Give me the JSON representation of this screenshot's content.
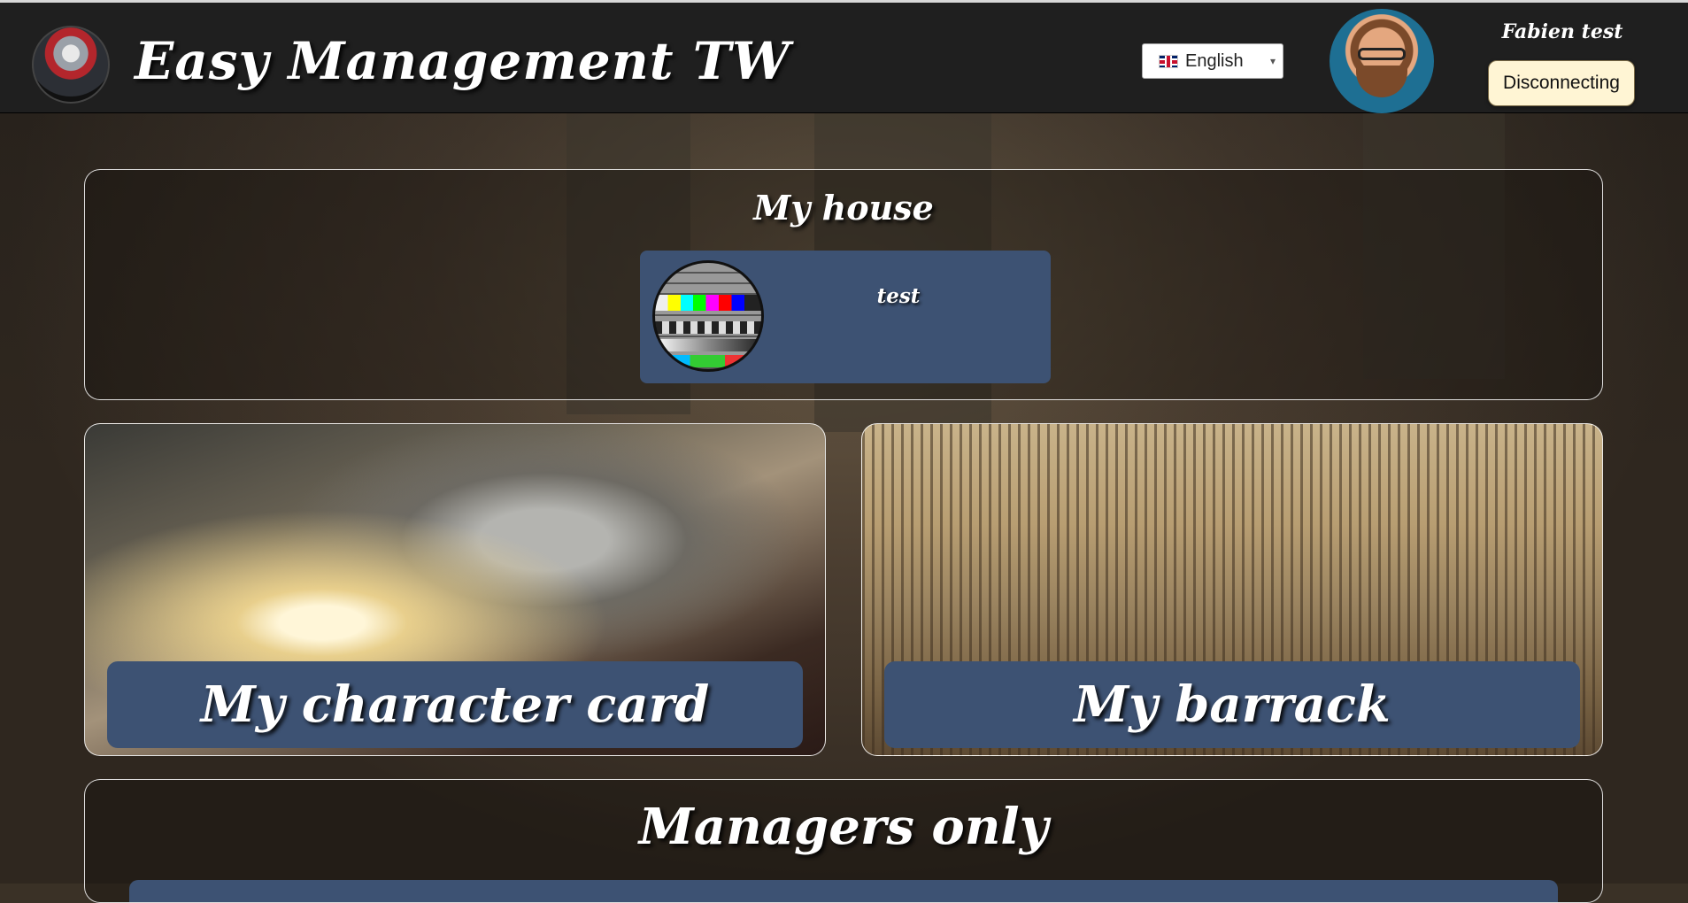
{
  "header": {
    "app_title": "Easy Management TW",
    "language": {
      "selected": "English",
      "flag": "uk-flag-icon"
    },
    "user": {
      "name": "Fabien test"
    },
    "disconnect_label": "Disconnecting"
  },
  "house": {
    "title": "My house",
    "card": {
      "name": "test",
      "emblem": "test-card-emblem"
    }
  },
  "tiles": [
    {
      "label": "My character card",
      "image": "knight-armor-image"
    },
    {
      "label": "My barrack",
      "image": "army-battlefield-image"
    }
  ],
  "managers": {
    "title": "Managers only"
  },
  "colors": {
    "header_bg": "#1f1f1f",
    "card_blue": "#3d5273",
    "button_cream": "#fff5d4"
  }
}
